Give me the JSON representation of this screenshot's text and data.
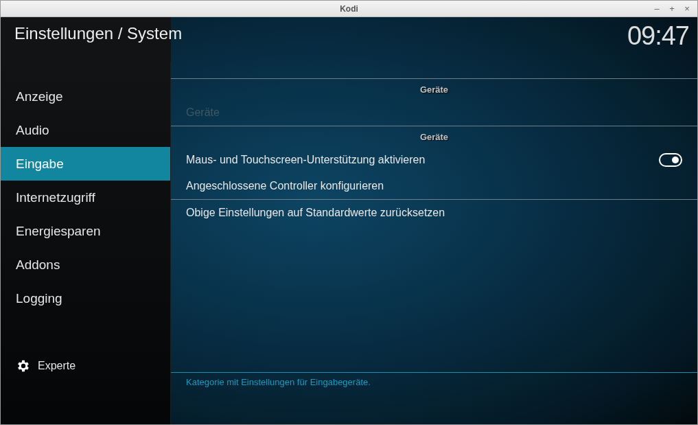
{
  "window": {
    "title": "Kodi",
    "controls": [
      "–",
      "+",
      "×"
    ]
  },
  "header": {
    "title": "Einstellungen / System",
    "clock": "09:47"
  },
  "sidebar": {
    "items": [
      {
        "label": "Anzeige",
        "selected": false
      },
      {
        "label": "Audio",
        "selected": false
      },
      {
        "label": "Eingabe",
        "selected": true
      },
      {
        "label": "Internetzugriff",
        "selected": false
      },
      {
        "label": "Energiesparen",
        "selected": false
      },
      {
        "label": "Addons",
        "selected": false
      },
      {
        "label": "Logging",
        "selected": false
      }
    ],
    "level_button": {
      "label": "Experte"
    }
  },
  "sections": [
    {
      "header": "Geräte",
      "items": [
        {
          "label": "Geräte",
          "kind": "item",
          "disabled": true
        }
      ]
    },
    {
      "header": "Geräte",
      "items": [
        {
          "label": "Maus- und Touchscreen-Unterstützung aktivieren",
          "kind": "toggle",
          "on": true
        },
        {
          "label": "Angeschlossene Controller konfigurieren",
          "kind": "item",
          "disabled": false
        }
      ]
    },
    {
      "items": [
        {
          "label": "Obige Einstellungen auf Standardwerte zurücksetzen",
          "kind": "item",
          "disabled": false
        }
      ]
    }
  ],
  "description": "Kategorie mit Einstellungen für Eingabegeräte."
}
